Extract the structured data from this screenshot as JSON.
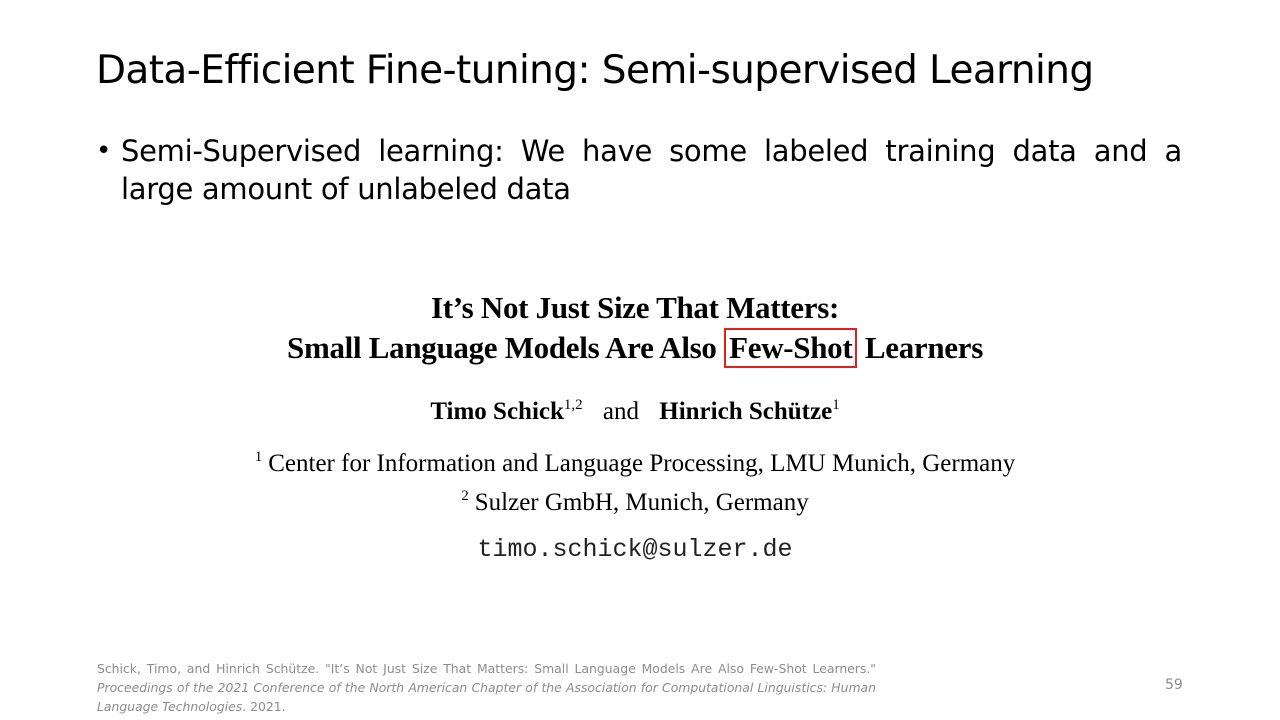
{
  "slide": {
    "title": "Data-Efficient Fine-tuning: Semi-supervised Learning",
    "bullet_symbol": "•",
    "bullet_text": "Semi-Supervised learning: We have some labeled training data and a large amount of unlabeled data",
    "page_number": "59"
  },
  "paper": {
    "title_line1": "It’s Not Just Size That Matters:",
    "title_line2_before": "Small Language Models Are Also",
    "title_highlight": "Few-Shot",
    "title_line2_after": "Learners",
    "author1_name": "Timo Schick",
    "author1_sup": "1,2",
    "author_and": "and",
    "author2_name": "Hinrich Schütze",
    "author2_sup": "1",
    "affil1_num": "1",
    "affil1_text": "Center for Information and Language Processing, LMU Munich, Germany",
    "affil2_num": "2",
    "affil2_text": "Sulzer GmbH, Munich, Germany",
    "email": "timo.schick@sulzer.de",
    "highlight_color": "#e0201f"
  },
  "citation": {
    "plain": "Schick, Timo, and Hinrich Schütze. \"It’s Not Just Size That Matters: Small Language Models Are Also Few-Shot Learners.\" ",
    "venue": "Proceedings of the 2021 Conference of the North American Chapter of the Association for Computational Linguistics: Human Language Technologies",
    "year": ". 2021."
  }
}
